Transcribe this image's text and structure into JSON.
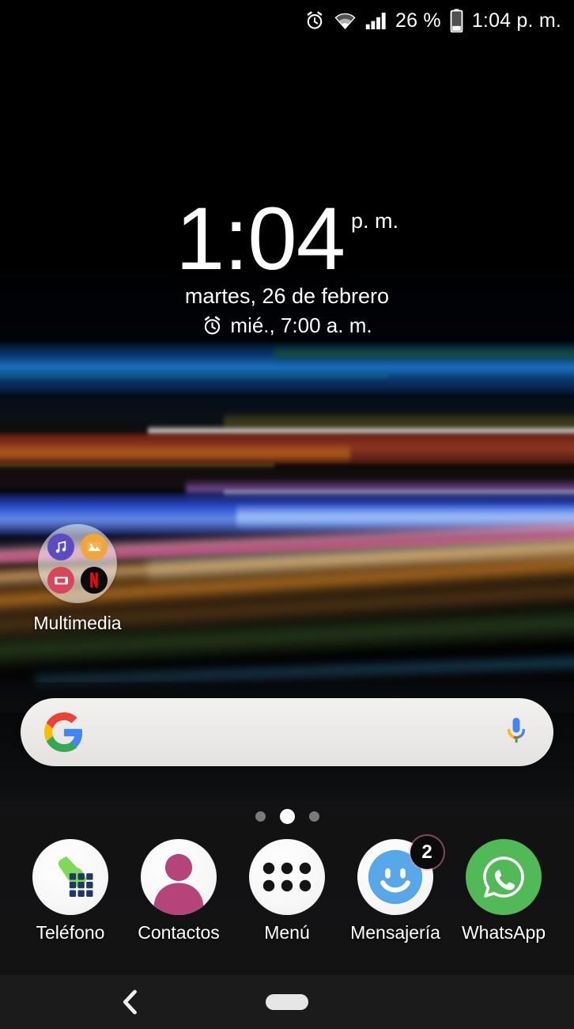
{
  "status_bar": {
    "alarm_icon": "alarm-clock-icon",
    "wifi_icon": "wifi-icon",
    "signal_icon": "cellular-signal-icon",
    "battery_percent": "26 %",
    "battery_icon": "battery-low-icon",
    "time": "1:04 p. m."
  },
  "clock_widget": {
    "time": "1:04",
    "ampm": "p. m.",
    "date": "martes, 26 de febrero",
    "alarm_icon": "alarm-clock-icon",
    "alarm_text": "mié., 7:00 a. m."
  },
  "folder": {
    "label": "Multimedia",
    "apps": [
      {
        "name": "music-app-icon",
        "glyph": "♫",
        "bg": "#5b4bc4",
        "fg": "#ffffff"
      },
      {
        "name": "gallery-app-icon",
        "glyph": "▲",
        "bg": "#f0a63a",
        "fg": "#ffffff"
      },
      {
        "name": "video-app-icon",
        "glyph": "■",
        "bg": "#d9455a",
        "fg": "#ffffff"
      },
      {
        "name": "netflix-app-icon",
        "glyph": "N",
        "bg": "#0a0a0a",
        "fg": "#e50914"
      }
    ]
  },
  "search": {
    "google_icon": "google-g-icon",
    "mic_icon": "microphone-icon",
    "placeholder": "",
    "value": ""
  },
  "page_indicator": {
    "total": 3,
    "active_index": 1
  },
  "dock": {
    "items": [
      {
        "label": "Teléfono",
        "icon": "phone-dialer-icon",
        "badge": null
      },
      {
        "label": "Contactos",
        "icon": "contacts-icon",
        "badge": null
      },
      {
        "label": "Menú",
        "icon": "app-drawer-icon",
        "badge": null
      },
      {
        "label": "Mensajería",
        "icon": "messaging-icon",
        "badge": "2"
      },
      {
        "label": "WhatsApp",
        "icon": "whatsapp-icon",
        "badge": null
      }
    ]
  },
  "nav_bar": {
    "back_icon": "back-chevron-icon",
    "home_icon": "home-pill-icon"
  },
  "colors": {
    "accent_green": "#7ed957",
    "whatsapp_green": "#4caf50",
    "messaging_blue": "#58a7e8",
    "contacts_pink": "#b4447a",
    "netflix_red": "#e50914",
    "nav_bar_bg": "#1b1b1c",
    "search_bar_bg": "#eceae8"
  }
}
